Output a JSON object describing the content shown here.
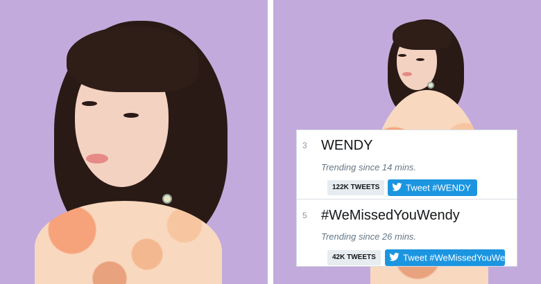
{
  "images": {
    "left_photo": "photo",
    "right_photo": "photo"
  },
  "trends": [
    {
      "rank": "3",
      "name": "WENDY",
      "since": "Trending since 14 mins.",
      "count": "122K TWEETS",
      "tweet_button": "Tweet #WENDY",
      "icon": "twitter-bird-icon"
    },
    {
      "rank": "5",
      "name": "#WeMissedYouWendy",
      "since": "Trending since 26 mins.",
      "count": "42K TWEETS",
      "tweet_button": "Tweet #WeMissedYouWendy",
      "icon": "twitter-bird-icon"
    }
  ],
  "colors": {
    "background_lavender": "#c2abdc",
    "tweet_blue": "#1b95e0",
    "badge_gray": "#e6ecf0"
  }
}
